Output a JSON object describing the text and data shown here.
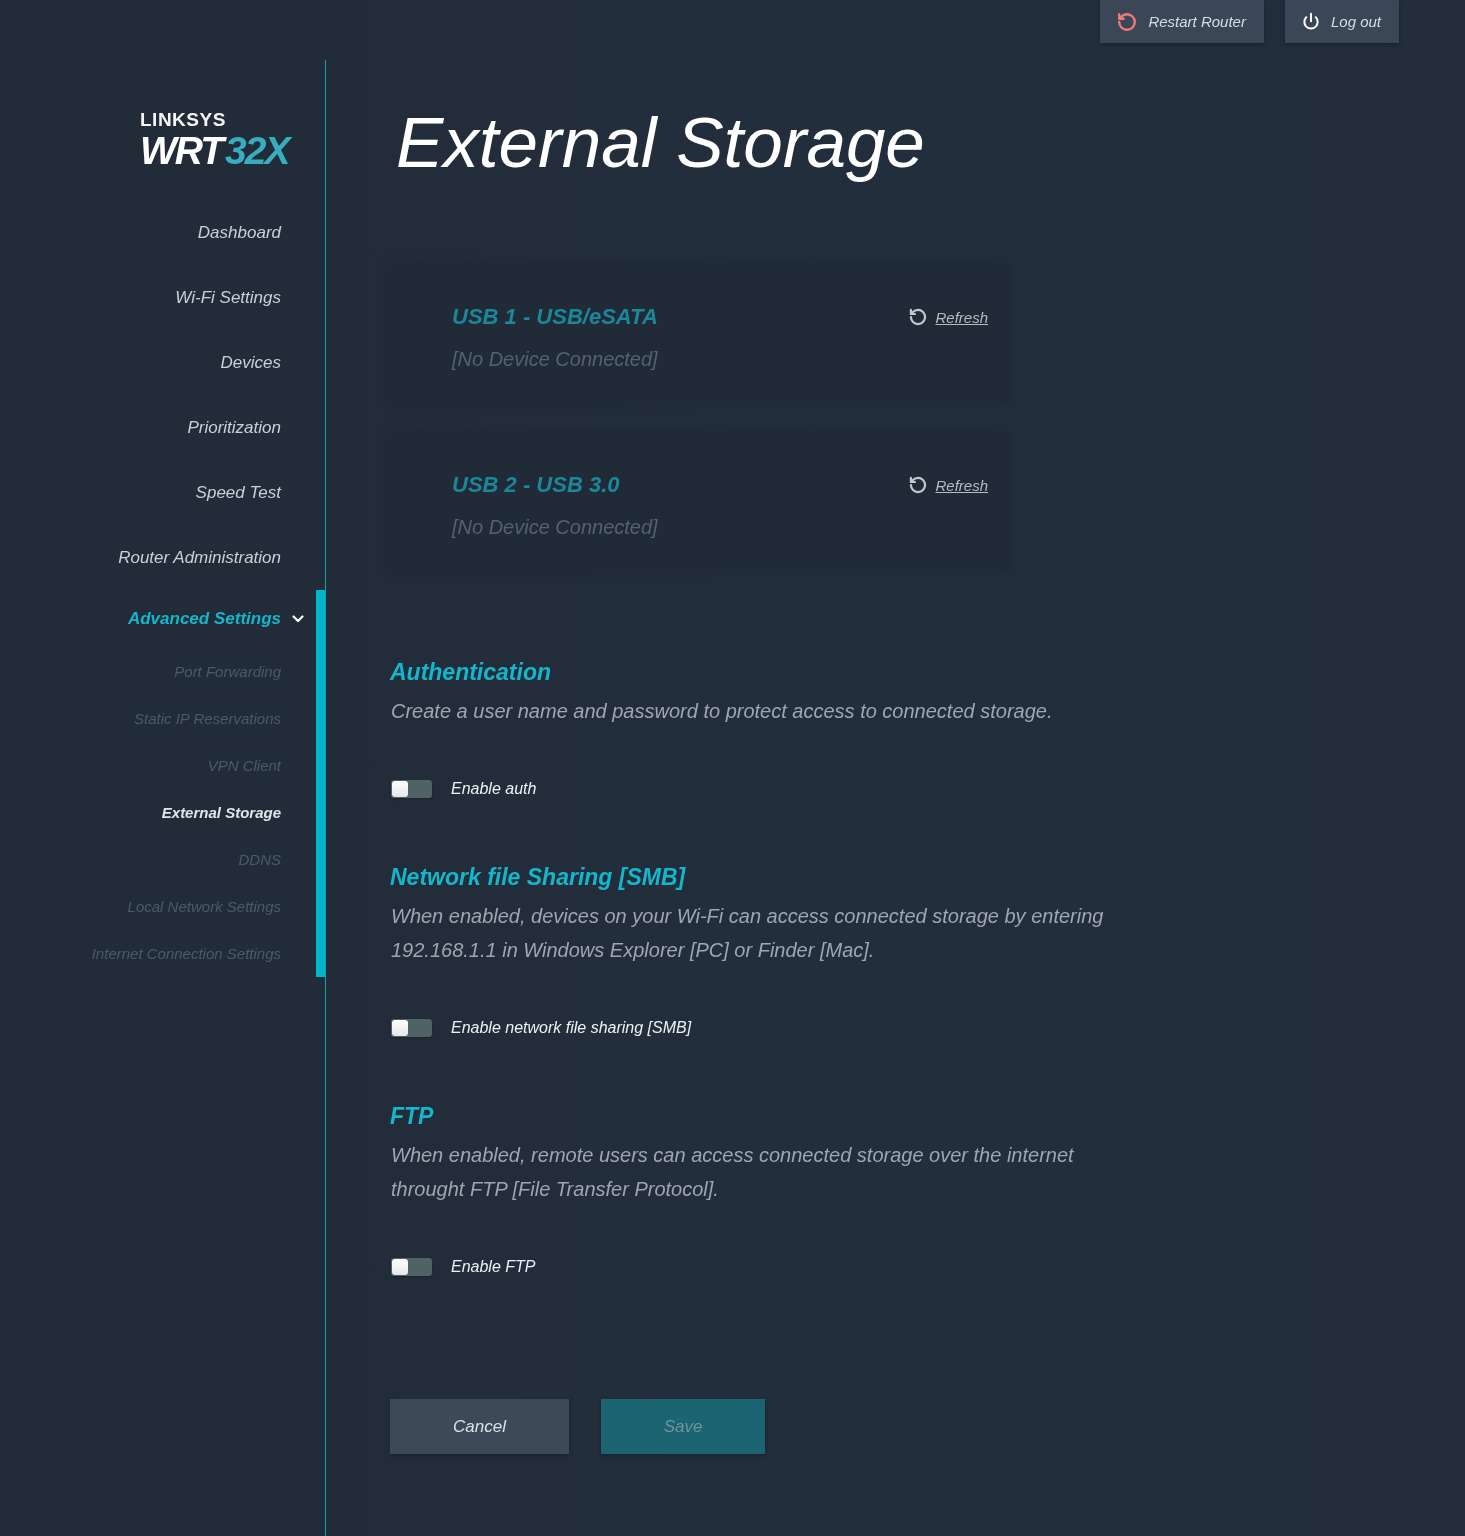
{
  "top_bar": {
    "buttons": [
      {
        "kind": "restart",
        "label": "Restart Router"
      },
      {
        "kind": "logout",
        "label": "Log out"
      }
    ]
  },
  "logo": {
    "brand": "LINKSYS",
    "model": "WRT",
    "model_number": "32X"
  },
  "sidebar": {
    "items": [
      {
        "kind": "link",
        "label": "Dashboard",
        "selected": false
      },
      {
        "kind": "link",
        "label": "Wi-Fi Settings",
        "selected": false
      },
      {
        "kind": "link",
        "label": "Devices",
        "selected": false
      },
      {
        "kind": "link",
        "label": "Prioritization",
        "selected": false
      },
      {
        "kind": "link",
        "label": "Speed Test",
        "selected": false
      },
      {
        "kind": "link",
        "label": "Router Administration",
        "selected": false
      },
      {
        "kind": "group",
        "label": "Advanced Settings",
        "selected": true,
        "expanded": true,
        "children": [
          {
            "label": "Port Forwarding",
            "selected": false
          },
          {
            "label": "Static IP Reservations",
            "selected": false
          },
          {
            "label": "VPN Client",
            "selected": false
          },
          {
            "label": "External Storage",
            "selected": true
          },
          {
            "label": "DDNS",
            "selected": false
          },
          {
            "label": "Local Network Settings",
            "selected": false
          },
          {
            "label": "Internet Connection Settings",
            "selected": false
          }
        ]
      }
    ]
  },
  "page": {
    "title": "External Storage"
  },
  "usb_ports": [
    {
      "title": "USB 1 - USB/eSATA",
      "status": "[No Device Connected]",
      "refresh": "Refresh"
    },
    {
      "title": "USB 2 - USB 3.0",
      "status": "[No Device Connected]",
      "refresh": "Refresh"
    }
  ],
  "sections": [
    {
      "heading": "Authentication",
      "description": "Create a user name and password to protect access to connected storage.",
      "toggle": {
        "label": "Enable auth",
        "on": false
      }
    },
    {
      "heading": "Network file Sharing [SMB]",
      "description": "When enabled, devices on your Wi-Fi can access connected storage by entering 192.168.1.1 in Windows Explorer [PC] or Finder [Mac].",
      "toggle": {
        "label": "Enable network file sharing [SMB]",
        "on": false
      }
    },
    {
      "heading": "FTP",
      "description": "When enabled, remote users can access connected storage over the internet throught FTP [File Transfer Protocol].",
      "toggle": {
        "label": "Enable FTP",
        "on": false
      }
    }
  ],
  "actions": [
    {
      "kind": "cancel",
      "label": "Cancel",
      "disabled": false
    },
    {
      "kind": "save",
      "label": "Save",
      "disabled": true
    }
  ]
}
